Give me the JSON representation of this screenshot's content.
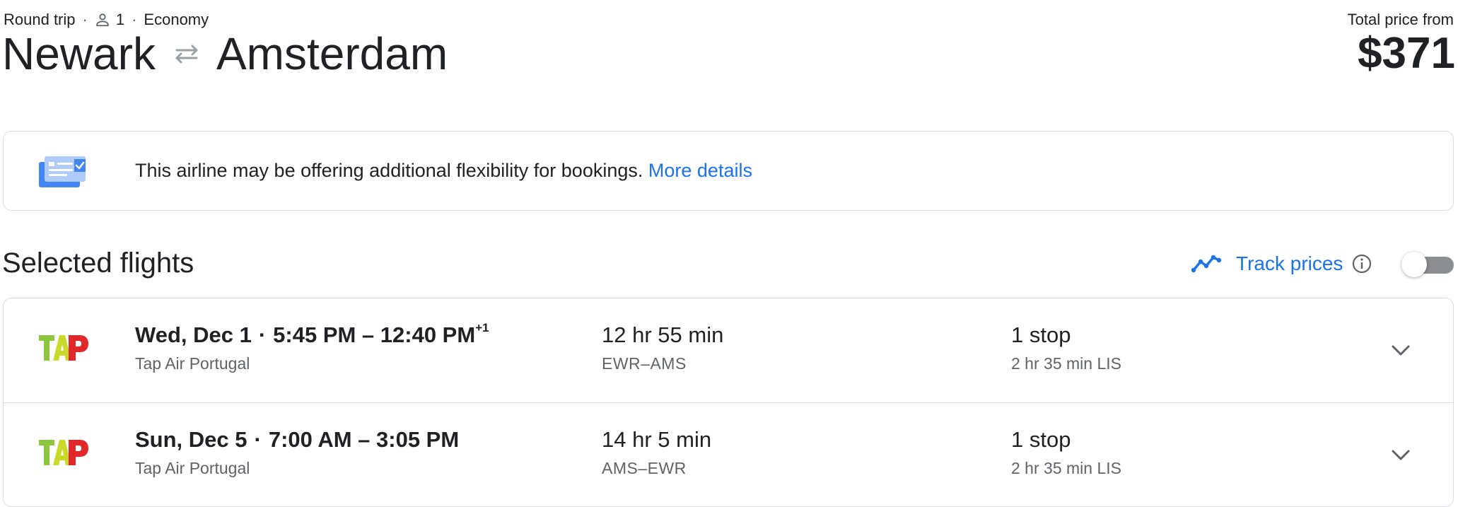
{
  "header": {
    "trip_type": "Round trip",
    "passengers": "1",
    "cabin_class": "Economy",
    "origin": "Newark",
    "destination": "Amsterdam",
    "total_label": "Total price from",
    "total_price": "$371"
  },
  "notice": {
    "text": "This airline may be offering additional flexibility for bookings. ",
    "link": "More details"
  },
  "selected": {
    "title": "Selected flights",
    "track_label": "Track prices",
    "track_enabled": false
  },
  "flights": [
    {
      "date": "Wed, Dec 1",
      "times": "5:45 PM – 12:40 PM",
      "day_offset": "+1",
      "airline": "Tap Air Portugal",
      "duration": "12 hr 55 min",
      "route": "EWR–AMS",
      "stops": "1 stop",
      "layover": "2 hr 35 min LIS"
    },
    {
      "date": "Sun, Dec 5",
      "times": "7:00 AM – 3:05 PM",
      "day_offset": "",
      "airline": "Tap Air Portugal",
      "duration": "14 hr 5 min",
      "route": "AMS–EWR",
      "stops": "1 stop",
      "layover": "2 hr 35 min LIS"
    }
  ],
  "icons": {
    "person": "person-outline-icon",
    "swap": "swap-arrows-icon",
    "flex_ticket": "flexible-ticket-icon",
    "track_chart": "trending-chart-icon",
    "info": "info-circle-icon",
    "expand": "chevron-down-icon",
    "airline_logo": "tap-air-portugal-logo"
  },
  "colors": {
    "accent": "#1a73e8",
    "text_primary": "#202124",
    "text_secondary": "#5f6368",
    "border": "#dadce0",
    "tap_green": "#8cc63f",
    "tap_red": "#e02729"
  }
}
